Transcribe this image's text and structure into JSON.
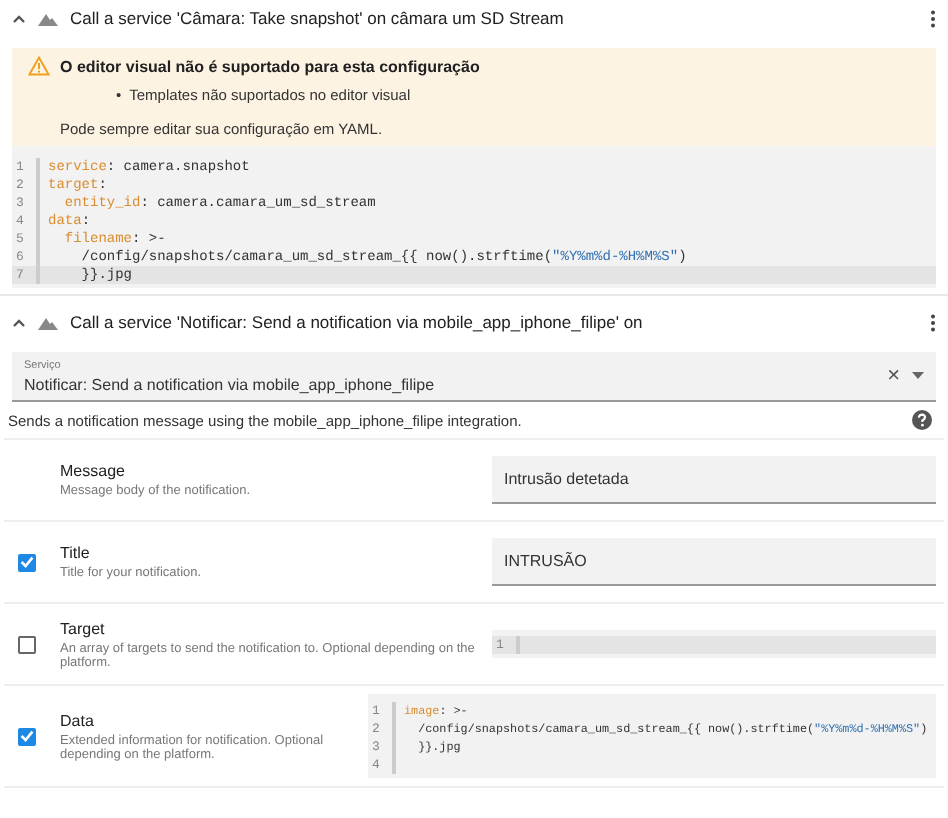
{
  "actions": [
    {
      "title": "Call a service 'Câmara: Take snapshot' on câmara um SD Stream",
      "expanded": true
    },
    {
      "title": "Call a service 'Notificar: Send a notification via mobile_app_iphone_filipe' on",
      "expanded": true
    }
  ],
  "warning": {
    "title": "O editor visual não é suportado para esta configuração",
    "bullets": [
      {
        "marker": "•",
        "text": "Templates não suportados no editor visual"
      }
    ],
    "footer": "Pode sempre editar sua configuração em YAML."
  },
  "yaml": [
    {
      "num": "1",
      "active": false,
      "parts": [
        {
          "kind": "key",
          "text": "service"
        },
        {
          "kind": "plain",
          "text": ": camera.snapshot"
        }
      ]
    },
    {
      "num": "2",
      "active": false,
      "parts": [
        {
          "kind": "key",
          "text": "target"
        },
        {
          "kind": "plain",
          "text": ":"
        }
      ],
      "children": [
        {
          "num": "3",
          "active": false,
          "parts": [
            {
              "kind": "key",
              "text": "entity_id"
            },
            {
              "kind": "plain",
              "text": ": camera.camara_um_sd_stream"
            }
          ]
        }
      ]
    },
    {
      "num": "4",
      "active": false,
      "parts": [
        {
          "kind": "key",
          "text": "data"
        },
        {
          "kind": "plain",
          "text": ":"
        }
      ],
      "children": [
        {
          "num": "5",
          "active": false,
          "parts": [
            {
              "kind": "key",
              "text": "filename"
            },
            {
              "kind": "plain",
              "text": ": >-"
            }
          ],
          "children": [
            {
              "num": "6",
              "active": false,
              "parts": [
                {
                  "kind": "plain",
                  "text": "/config/snapshots/camara_um_sd_stream_{{ now().strftime("
                },
                {
                  "kind": "string",
                  "text": "\"%Y%m%d-%H%M%S\""
                },
                {
                  "kind": "plain",
                  "text": ")"
                }
              ]
            },
            {
              "num": "7",
              "active": true,
              "parts": [
                {
                  "kind": "plain",
                  "text": "}}.jpg"
                }
              ]
            }
          ]
        }
      ]
    }
  ],
  "service": {
    "label": "Serviço",
    "value": "Notificar: Send a notification via mobile_app_iphone_filipe",
    "clear": "×"
  },
  "description": "Sends a notification message using the mobile_app_iphone_filipe integration.",
  "fields": [
    {
      "name": "Message",
      "help": "Message body of the notification.",
      "kind": "text",
      "value": "Intrusão detetada"
    },
    {
      "name": "Title",
      "help": "Title for your notification.",
      "kind": "text",
      "checked": true,
      "value": "INTRUSÃO"
    },
    {
      "name": "Target",
      "help": "An array of targets to send the notification to. Optional depending on the platform.",
      "kind": "code",
      "checked": false,
      "lines": [
        {
          "num": "1",
          "active": true
        }
      ]
    },
    {
      "name": "Data",
      "help": "Extended information for notification. Optional depending on the platform.",
      "kind": "code",
      "checked": true,
      "lines": [
        {
          "num": "1",
          "active": false,
          "parts": [
            {
              "kind": "key",
              "text": "image"
            },
            {
              "kind": "plain",
              "text": ": >-"
            }
          ],
          "children": [
            {
              "num": "2",
              "active": false,
              "parts": [
                {
                  "kind": "plain",
                  "text": "/config/snapshots/camara_um_sd_stream_{{ now().strftime("
                },
                {
                  "kind": "string",
                  "text": "\"%Y%m%d-%H%M%S\""
                },
                {
                  "kind": "plain",
                  "text": ")"
                }
              ]
            },
            {
              "num": "3",
              "active": false,
              "parts": [
                {
                  "kind": "plain",
                  "text": "}}.jpg"
                }
              ]
            }
          ]
        },
        {
          "num": "4",
          "active": false
        }
      ]
    }
  ]
}
